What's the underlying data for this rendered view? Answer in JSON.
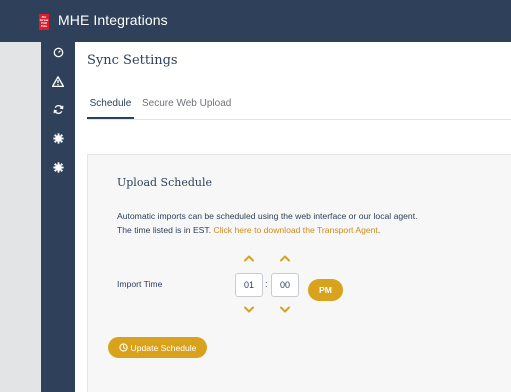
{
  "header": {
    "logo_lines": [
      "Mc",
      "Graw",
      "Hill",
      "Edu"
    ],
    "title": "MHE Integrations"
  },
  "sidebar": {
    "icons": [
      "dashboard-icon",
      "warning-icon",
      "sync-icon",
      "settings-gear-icon",
      "settings-gear-icon"
    ]
  },
  "page": {
    "title": "Sync Settings"
  },
  "tabs": [
    {
      "label": "Schedule",
      "active": true
    },
    {
      "label": "Secure Web Upload",
      "active": false
    }
  ],
  "card": {
    "title": "Upload Schedule",
    "desc_line1": "Automatic imports can be scheduled using the web interface or our local agent.",
    "desc_line2_prefix": "The time listed is in EST. ",
    "desc_link": "Click here to download the Transport Agent",
    "desc_line2_suffix": "."
  },
  "schedule": {
    "label": "Import Time",
    "hour": "01",
    "separator": ":",
    "minute": "00",
    "meridiem": "PM"
  },
  "actions": {
    "update_label": "Update Schedule"
  },
  "colors": {
    "navy": "#2e405a",
    "accent": "#d8a21d",
    "link": "#d08a16",
    "brand_red": "#e21b2b"
  }
}
